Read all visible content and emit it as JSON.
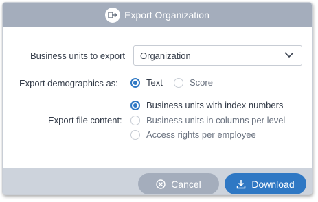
{
  "dialog": {
    "title": "Export Organization"
  },
  "form": {
    "business_units": {
      "label": "Business units to export",
      "value": "Organization"
    },
    "demographics": {
      "label": "Export demographics as:",
      "options": [
        {
          "label": "Text",
          "checked": true
        },
        {
          "label": "Score",
          "checked": false
        }
      ]
    },
    "file_content": {
      "label": "Export file content:",
      "options": [
        {
          "label": "Business units with index numbers",
          "checked": true
        },
        {
          "label": "Business units in columns per level",
          "checked": false
        },
        {
          "label": "Access rights per employee",
          "checked": false
        }
      ]
    }
  },
  "footer": {
    "cancel_label": "Cancel",
    "download_label": "Download"
  },
  "colors": {
    "accent": "#2f78c4",
    "titlebar": "#a4adbc",
    "footer": "#cdd3dc"
  },
  "icons": {
    "title": "export-icon",
    "select": "chevron-down-icon",
    "cancel": "cancel-circle-icon",
    "download": "download-icon"
  }
}
